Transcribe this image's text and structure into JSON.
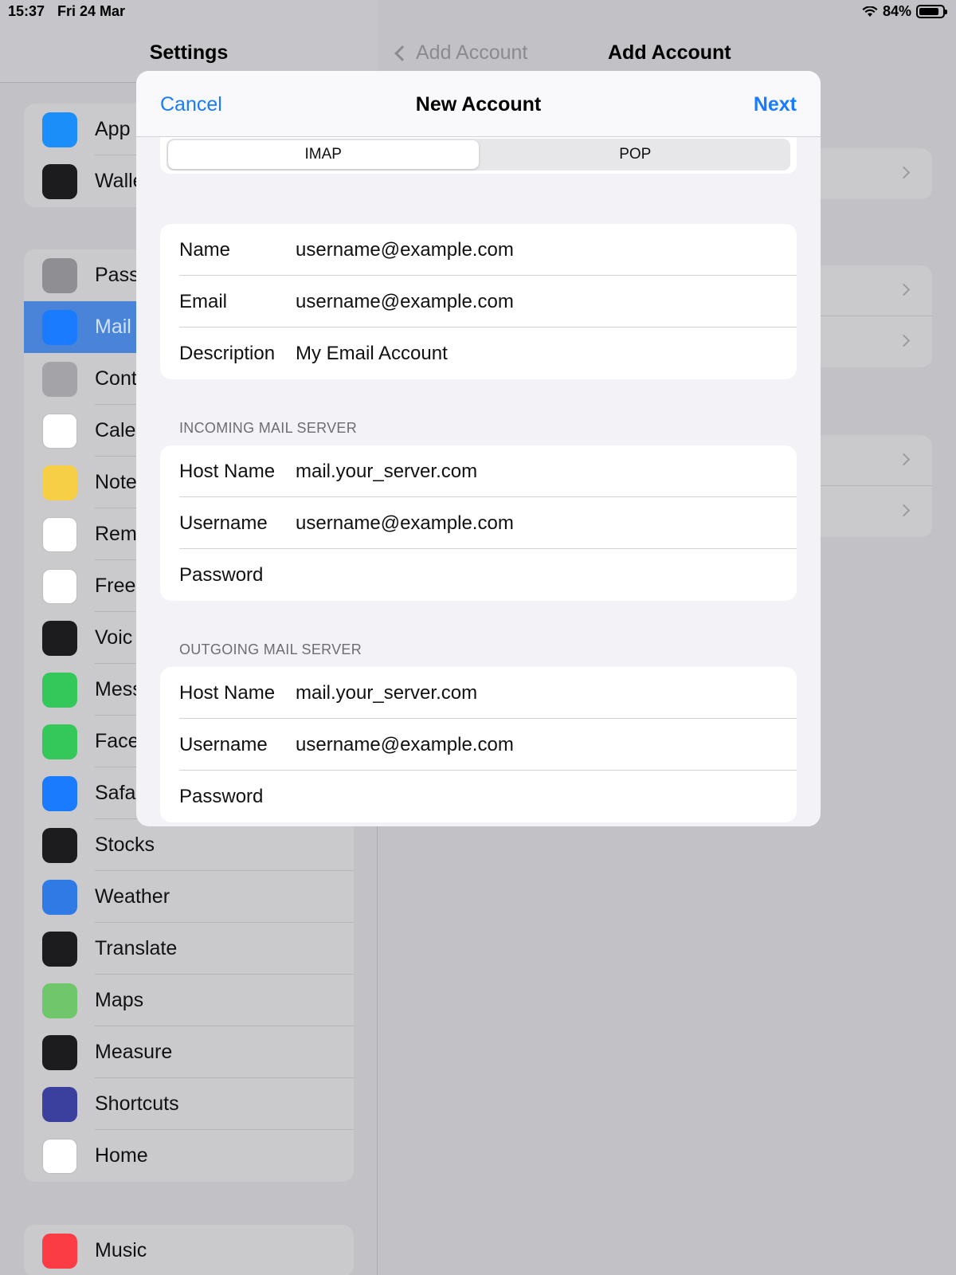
{
  "status_bar": {
    "time": "15:37",
    "date": "Fri 24 Mar",
    "battery": "84%",
    "battery_level": 0.84
  },
  "settings": {
    "title": "Settings",
    "groups": [
      {
        "items": [
          {
            "label": "App",
            "icon": "app-store-icon",
            "color": "#1c8ef9"
          },
          {
            "label": "Walle",
            "icon": "wallet-icon",
            "color": "#1c1c1e"
          }
        ]
      },
      {
        "items": [
          {
            "label": "Pass",
            "icon": "key-icon",
            "color": "#8e8e93"
          },
          {
            "label": "Mail",
            "icon": "mail-icon",
            "color": "#1a7bff",
            "selected": true
          },
          {
            "label": "Cont",
            "icon": "contacts-icon",
            "color": "#a3a3a8"
          },
          {
            "label": "Cale",
            "icon": "calendar-icon",
            "color": "#ffffff"
          },
          {
            "label": "Note",
            "icon": "notes-icon",
            "color": "#f7cf46"
          },
          {
            "label": "Rem",
            "icon": "reminders-icon",
            "color": "#ffffff"
          },
          {
            "label": "Free",
            "icon": "freeform-icon",
            "color": "#ffffff"
          },
          {
            "label": "Voic",
            "icon": "voice-memos-icon",
            "color": "#1c1c1e"
          },
          {
            "label": "Mess",
            "icon": "messages-icon",
            "color": "#34c759"
          },
          {
            "label": "Face",
            "icon": "facetime-icon",
            "color": "#34c759"
          },
          {
            "label": "Safa",
            "icon": "safari-icon",
            "color": "#1a7bff"
          },
          {
            "label": "Stocks",
            "icon": "stocks-icon",
            "color": "#1c1c1e"
          },
          {
            "label": "Weather",
            "icon": "weather-icon",
            "color": "#2f7ae5"
          },
          {
            "label": "Translate",
            "icon": "translate-icon",
            "color": "#1c1c1e"
          },
          {
            "label": "Maps",
            "icon": "maps-icon",
            "color": "#6fc66b"
          },
          {
            "label": "Measure",
            "icon": "measure-icon",
            "color": "#1c1c1e"
          },
          {
            "label": "Shortcuts",
            "icon": "shortcuts-icon",
            "color": "#3b3f9e"
          },
          {
            "label": "Home",
            "icon": "home-icon",
            "color": "#ffffff"
          }
        ]
      },
      {
        "items": [
          {
            "label": "Music",
            "icon": "music-icon",
            "color": "#fc3c44"
          }
        ]
      }
    ]
  },
  "detail": {
    "back_label": "Add Account",
    "title": "Add Account"
  },
  "modal": {
    "cancel": "Cancel",
    "title": "New Account",
    "next": "Next",
    "segments": [
      {
        "label": "IMAP",
        "selected": true
      },
      {
        "label": "POP",
        "selected": false
      }
    ],
    "account": [
      {
        "label": "Name",
        "value": "username@example.com"
      },
      {
        "label": "Email",
        "value": "username@example.com"
      },
      {
        "label": "Description",
        "value": "My Email Account"
      }
    ],
    "incoming": {
      "header": "INCOMING MAIL SERVER",
      "rows": [
        {
          "label": "Host Name",
          "value": "mail.your_server.com"
        },
        {
          "label": "Username",
          "value": "username@example.com"
        },
        {
          "label": "Password",
          "value": ""
        }
      ]
    },
    "outgoing": {
      "header": "OUTGOING MAIL SERVER",
      "rows": [
        {
          "label": "Host Name",
          "value": "mail.your_server.com"
        },
        {
          "label": "Username",
          "value": "username@example.com"
        },
        {
          "label": "Password",
          "value": ""
        }
      ]
    }
  },
  "accent_color": "#1a7bff"
}
